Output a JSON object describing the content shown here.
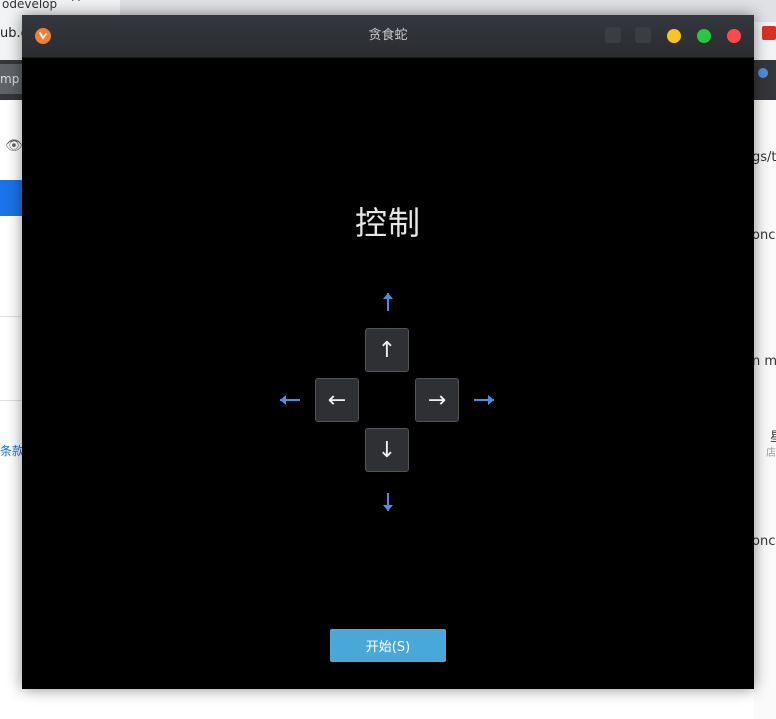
{
  "background_browser": {
    "tab_title": "odevelop",
    "tab_close": "✕",
    "url_fragment": "ub.c",
    "toolbar_fragment": "mp",
    "link_fragment": "条款",
    "right_fragments": [
      "gs/t",
      "onc",
      "n m",
      "星",
      "店",
      "onc"
    ]
  },
  "window": {
    "title": "贪食蛇",
    "colors": {
      "minimize": "#f7c325",
      "maximize": "#28c840",
      "close": "#ff4a4a",
      "app_icon": "#f08030"
    }
  },
  "controls": {
    "heading": "控制",
    "keys": {
      "up": "↑",
      "left": "←",
      "right": "→",
      "down": "↓"
    },
    "hint_arrow_color": "#4a90e2"
  },
  "start_button": {
    "label": "开始(S)",
    "color": "#4aa8d8"
  }
}
